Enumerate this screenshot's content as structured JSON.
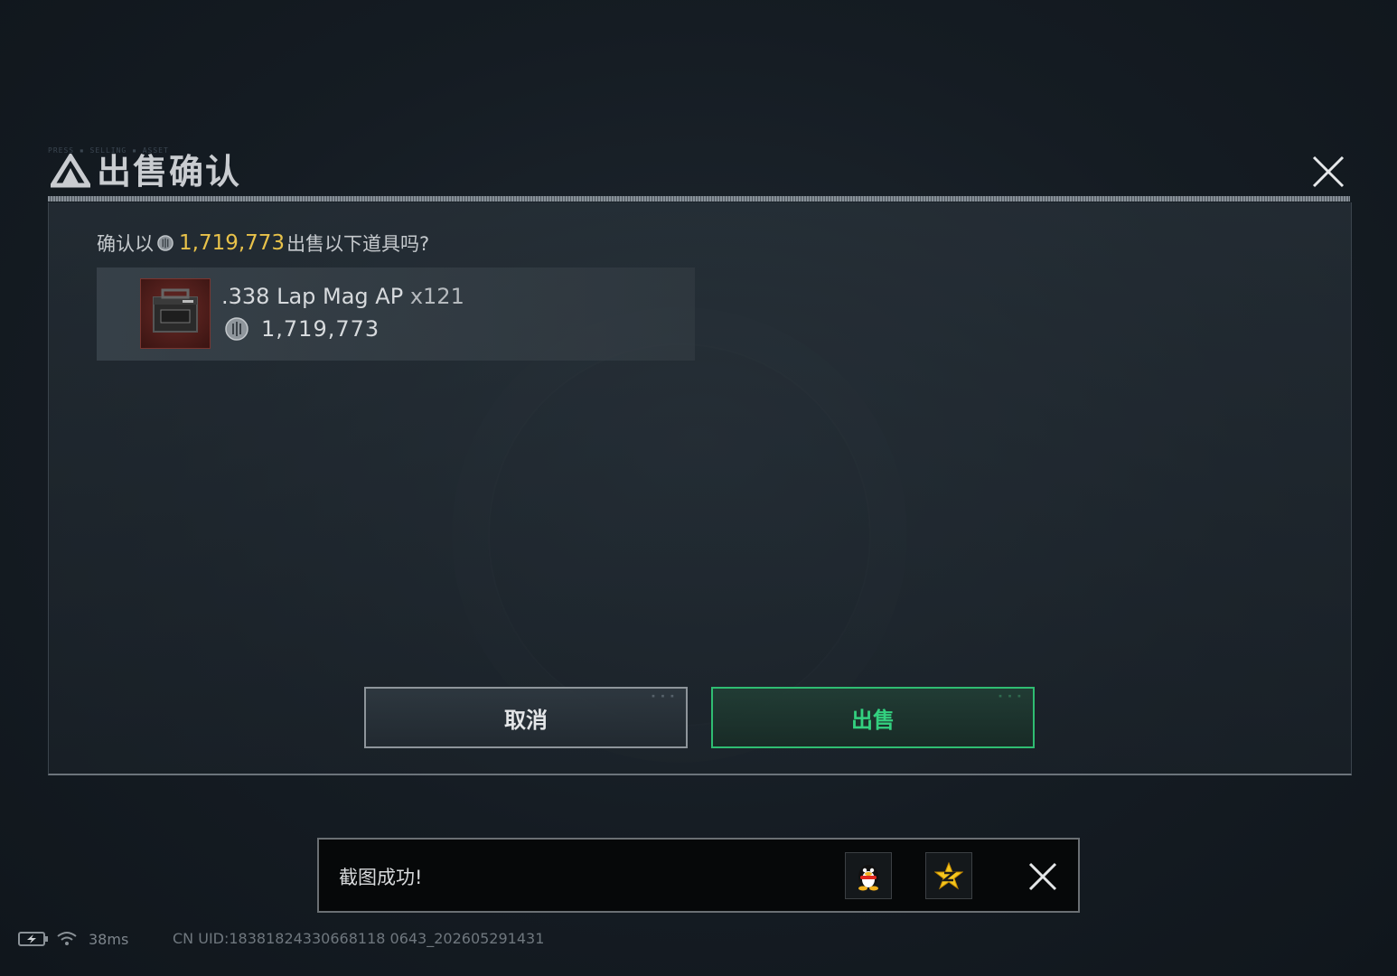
{
  "dialog": {
    "title": "出售确认",
    "header_micro": "PRESS ▪ SELLING ▪ ASSET",
    "confirm_prefix": "确认以",
    "confirm_price": "1,719,773",
    "confirm_suffix": "出售以下道具吗?",
    "item": {
      "name": ".338 Lap Mag AP",
      "quantity": "x121",
      "price": "1,719,773"
    },
    "buttons": {
      "cancel": "取消",
      "sell": "出售"
    },
    "colors": {
      "price_gold": "#e8c24a",
      "sell_green": "#2fbd72"
    }
  },
  "toast": {
    "message": "截图成功!",
    "share_icons": [
      "qq-penguin-icon",
      "qzone-star-icon"
    ]
  },
  "status": {
    "latency": "38ms",
    "uid": "CN UID:18381824330668118 0643_202605291431"
  }
}
